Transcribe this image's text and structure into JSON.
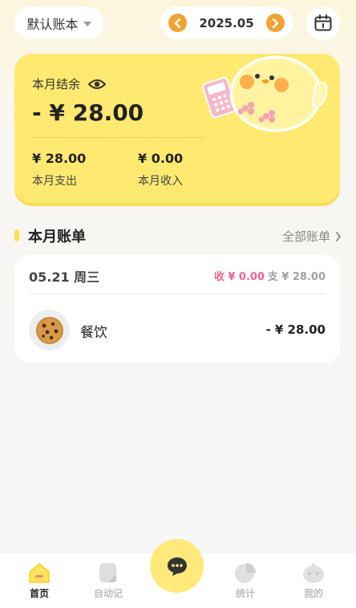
{
  "header": {
    "book_name": "默认账本",
    "month": "2025.05",
    "icons": {
      "prev": "chevron-left-icon",
      "next": "chevron-right-icon",
      "calendar": "calendar-icon"
    }
  },
  "summary": {
    "balance_label": "本月结余",
    "balance_value": "- ¥ 28.00",
    "expense_value": "¥ 28.00",
    "expense_label": "本月支出",
    "income_value": "¥ 0.00",
    "income_label": "本月收入"
  },
  "bills": {
    "section_title": "本月账单",
    "all_link": "全部账单",
    "days": [
      {
        "date": "05.21 周三",
        "income": "收 ¥ 0.00",
        "expense": "支 ¥ 28.00",
        "items": [
          {
            "category": "餐饮",
            "amount": "- ¥ 28.00",
            "icon": "cookie-icon"
          }
        ]
      }
    ]
  },
  "tabbar": {
    "tabs": [
      {
        "label": "首页",
        "icon": "home-icon",
        "active": true
      },
      {
        "label": "自动记",
        "icon": "note-icon",
        "active": false
      },
      {
        "label": "统计",
        "icon": "pie-chart-icon",
        "active": false
      },
      {
        "label": "我的",
        "icon": "profile-icon",
        "active": false
      }
    ],
    "center_icon": "chat-bubble-icon"
  },
  "colors": {
    "accent_yellow": "#ffe970",
    "orange": "#f2a233",
    "income_pink": "#f06292"
  }
}
